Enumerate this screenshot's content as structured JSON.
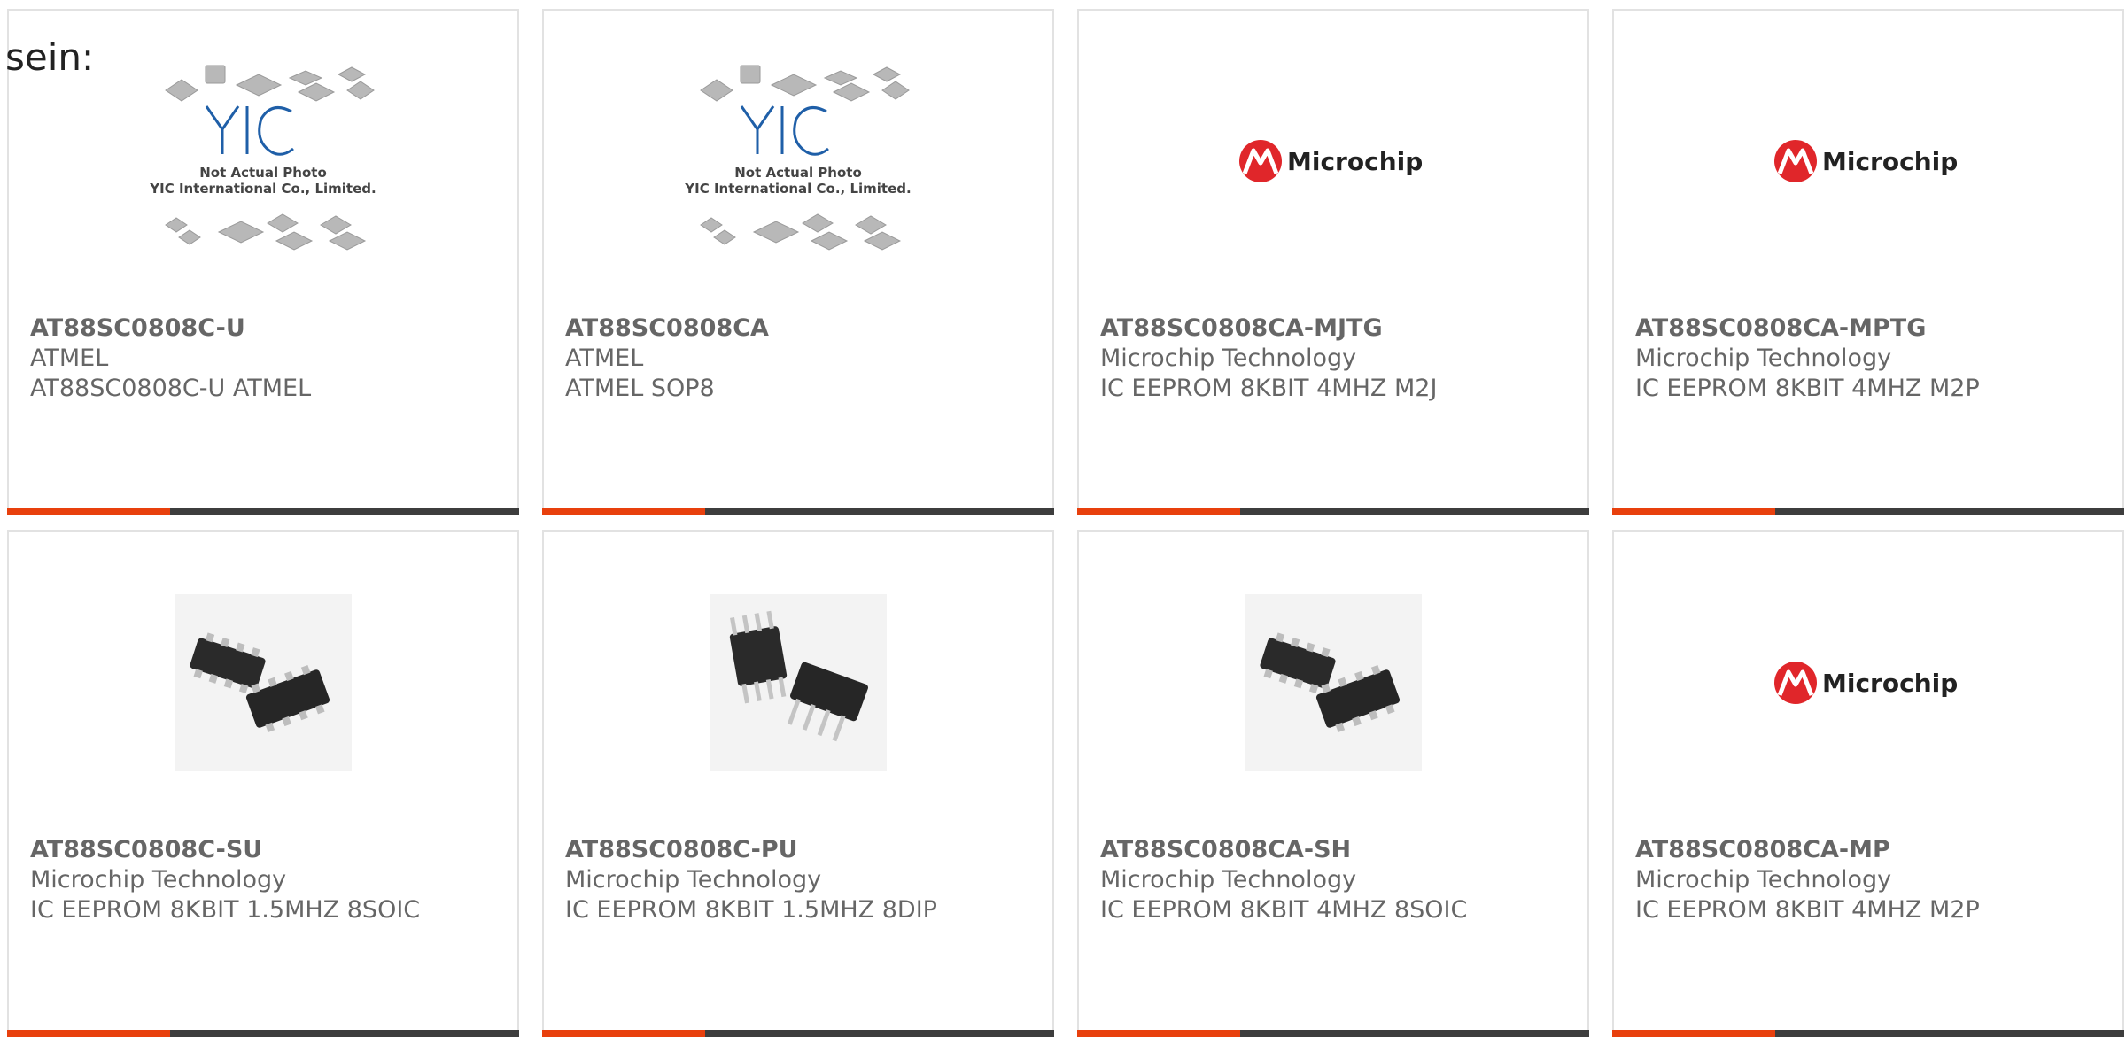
{
  "intro_text": "sein:",
  "placeholder": {
    "line1": "Not Actual Photo",
    "line2": "YIC International Co., Limited."
  },
  "logo_text": "Microchip",
  "colors": {
    "accent": "#e8400d",
    "bar": "#3d3d3d",
    "microchip_red": "#e0262a",
    "yic_blue": "#1f5fa8",
    "text": "#666666"
  },
  "products": [
    {
      "part_number": "AT88SC0808C-U",
      "manufacturer": "ATMEL",
      "description": "AT88SC0808C-U ATMEL",
      "image": "yic-placeholder"
    },
    {
      "part_number": "AT88SC0808CA",
      "manufacturer": "ATMEL",
      "description": "ATMEL SOP8",
      "image": "yic-placeholder"
    },
    {
      "part_number": "AT88SC0808CA-MJTG",
      "manufacturer": "Microchip Technology",
      "description": "IC EEPROM 8KBIT 4MHZ M2J",
      "image": "microchip-logo"
    },
    {
      "part_number": "AT88SC0808CA-MPTG",
      "manufacturer": "Microchip Technology",
      "description": "IC EEPROM 8KBIT 4MHZ M2P",
      "image": "microchip-logo"
    },
    {
      "part_number": "AT88SC0808C-SU",
      "manufacturer": "Microchip Technology",
      "description": "IC EEPROM 8KBIT 1.5MHZ 8SOIC",
      "image": "soic-chips"
    },
    {
      "part_number": "AT88SC0808C-PU",
      "manufacturer": "Microchip Technology",
      "description": "IC EEPROM 8KBIT 1.5MHZ 8DIP",
      "image": "dip-chips"
    },
    {
      "part_number": "AT88SC0808CA-SH",
      "manufacturer": "Microchip Technology",
      "description": "IC EEPROM 8KBIT 4MHZ 8SOIC",
      "image": "soic-chips"
    },
    {
      "part_number": "AT88SC0808CA-MP",
      "manufacturer": "Microchip Technology",
      "description": "IC EEPROM 8KBIT 4MHZ M2P",
      "image": "microchip-logo"
    }
  ]
}
